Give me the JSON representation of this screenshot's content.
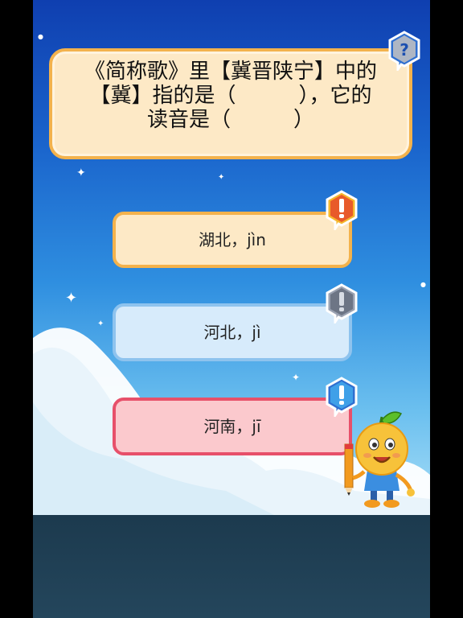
{
  "question": {
    "lines": [
      "《简称歌》里【冀晋陕宁】中的",
      "【冀】指的是（　　　），它的",
      "读音是（　　　）"
    ]
  },
  "answers": [
    {
      "label": "湖北，jìn",
      "state": "default",
      "badge_icon": "exclamation-red-icon"
    },
    {
      "label": "河北，jì",
      "state": "neutral",
      "badge_icon": "exclamation-gray-icon"
    },
    {
      "label": "河南，jī",
      "state": "wrong",
      "badge_icon": "exclamation-blue-icon"
    }
  ],
  "icons": {
    "help": "question-mark-icon",
    "mascot": "orange-mascot-with-pencil"
  },
  "colors": {
    "sky_top": "#0f3fb0",
    "sky_bottom": "#a9def7",
    "card_fill": "#fde9c6",
    "card_border": "#f3b24c",
    "blue_fill": "#d7ebfb",
    "blue_border": "#8ec3ee",
    "red_fill": "#fbc9cd",
    "red_border": "#e7506a",
    "bottom_bar": "#1c3a4e"
  }
}
